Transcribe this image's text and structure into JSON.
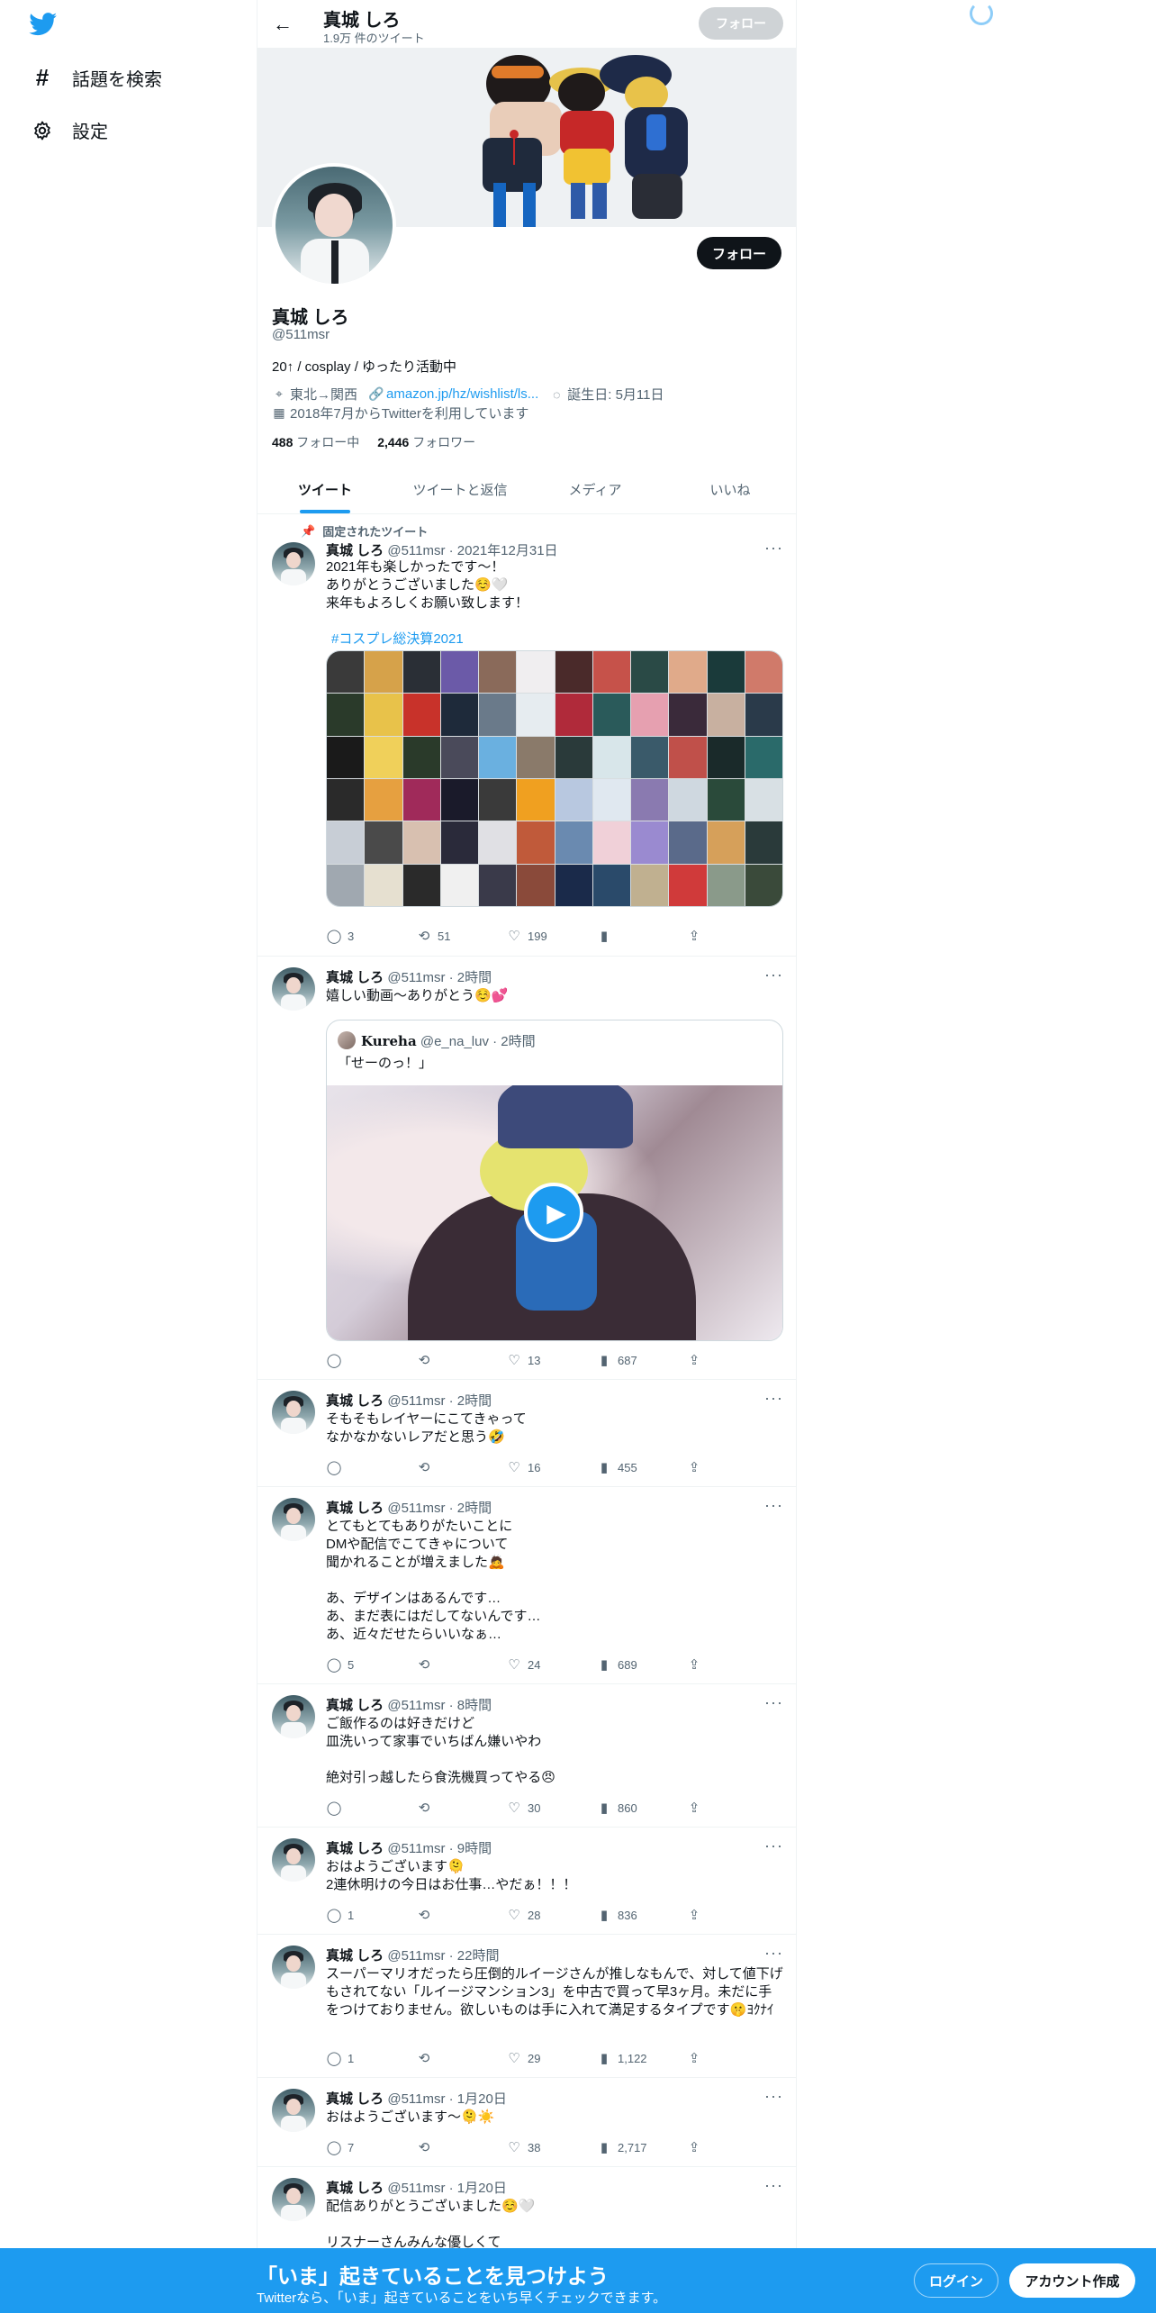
{
  "nav": {
    "explore_label": "話題を検索",
    "settings_label": "設定"
  },
  "header": {
    "name": "真城 しろ",
    "tweet_count": "1.9万 件のツイート",
    "follow_label": "フォロー"
  },
  "profile": {
    "follow_label": "フォロー",
    "name": "真城 しろ",
    "handle": "@511msr",
    "bio": "20↑ / cosplay / ゆったり活動中",
    "location": "東北→関西",
    "website": "amazon.jp/hz/wishlist/ls...",
    "birthday": "誕生日: 5月11日",
    "joined": "2018年7月からTwitterを利用しています",
    "following_count": "488",
    "following_label": "フォロー中",
    "followers_count": "2,446",
    "followers_label": "フォロワー"
  },
  "tabs": [
    {
      "label": "ツイート",
      "active": true
    },
    {
      "label": "ツイートと返信",
      "active": false
    },
    {
      "label": "メディア",
      "active": false
    },
    {
      "label": "いいね",
      "active": false
    }
  ],
  "pinned_label": "固定されたツイート",
  "tweets": [
    {
      "name": "真城 しろ",
      "meta": "@511msr · 2021年12月31日",
      "text": "2021年も楽しかったです〜！\nありがとうございました☺️🤍\n来年もよろしくお願い致します！",
      "hashtag": "#コスプレ総決算2021",
      "replies": "3",
      "retweets": "51",
      "likes": "199",
      "views": ""
    },
    {
      "name": "真城 しろ",
      "meta": "@511msr · 2時間",
      "text": "嬉しい動画〜ありがとう☺️💕",
      "quote": {
        "name": "Kureha",
        "meta": "@e_na_luv · 2時間",
        "text": "「せーのっ！」"
      },
      "replies": "",
      "retweets": "",
      "likes": "13",
      "views": "687"
    },
    {
      "name": "真城 しろ",
      "meta": "@511msr · 2時間",
      "text": "そもそもレイヤーにこてきゃって\nなかなかないレアだと思う🤣",
      "replies": "",
      "retweets": "",
      "likes": "16",
      "views": "455"
    },
    {
      "name": "真城 しろ",
      "meta": "@511msr · 2時間",
      "text": "とてもとてもありがたいことに\nDMや配信でこてきゃについて\n聞かれることが増えました🙇\n\nあ、デザインはあるんです…\nあ、まだ表にはだしてないんです…\nあ、近々だせたらいいなぁ…",
      "replies": "5",
      "retweets": "",
      "likes": "24",
      "views": "689"
    },
    {
      "name": "真城 しろ",
      "meta": "@511msr · 8時間",
      "text": "ご飯作るのは好きだけど\n皿洗いって家事でいちばん嫌いやわ\n\n絶対引っ越したら食洗機買ってやる😠",
      "replies": "",
      "retweets": "",
      "likes": "30",
      "views": "860"
    },
    {
      "name": "真城 しろ",
      "meta": "@511msr · 9時間",
      "text": "おはようございます🫠\n2連休明けの今日はお仕事…やだぁ！！！",
      "replies": "1",
      "retweets": "",
      "likes": "28",
      "views": "836"
    },
    {
      "name": "真城 しろ",
      "meta": "@511msr · 22時間",
      "text": "スーパーマリオだったら圧倒的ルイージさんが推しなもんで、対して値下げもされてない「ルイージマンション3」を中古で買って早3ヶ月。未だに手をつけておりません。欲しいものは手に入れて満足するタイプです🤫ﾖｸﾅｲ",
      "replies": "1",
      "retweets": "",
      "likes": "29",
      "views": "1,122"
    },
    {
      "name": "真城 しろ",
      "meta": "@511msr · 1月20日",
      "text": "おはようございます〜🫠☀️",
      "replies": "7",
      "retweets": "",
      "likes": "38",
      "views": "2,717"
    },
    {
      "name": "真城 しろ",
      "meta": "@511msr · 1月20日",
      "text": "配信ありがとうございました☺️🤍\n\nリスナーさんみんな優しくて",
      "replies": "",
      "retweets": "",
      "likes": "",
      "views": ""
    }
  ],
  "bottom_bar": {
    "title": "「いま」起きていることを見つけよう",
    "subtitle": "Twitterなら、「いま」起きていることをいち早くチェックできます。",
    "login_label": "ログイン",
    "signup_label": "アカウント作成"
  },
  "colors": {
    "accent": "#1d9bf0",
    "text": "#0f1419",
    "muted": "#536471"
  },
  "icons": [
    "twitter-logo-icon",
    "hashtag-icon",
    "gear-icon",
    "back-arrow-icon",
    "location-icon",
    "link-icon",
    "balloon-icon",
    "calendar-icon",
    "pin-icon",
    "more-icon",
    "reply-icon",
    "retweet-icon",
    "like-icon",
    "views-icon",
    "share-icon",
    "play-icon"
  ]
}
